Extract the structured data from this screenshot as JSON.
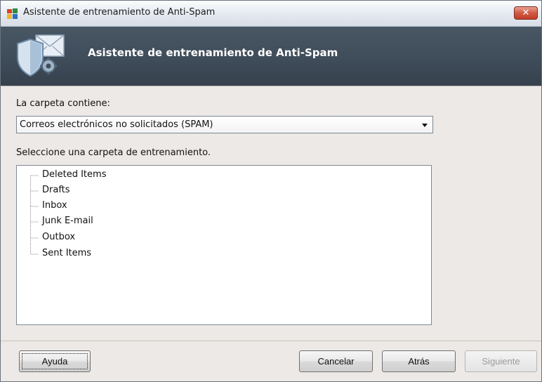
{
  "window": {
    "title": "Asistente de entrenamiento de Anti-Spam",
    "close_label": "✕"
  },
  "header": {
    "title": "Asistente de entrenamiento de Anti-Spam"
  },
  "form": {
    "folder_contains_label": "La carpeta contiene:",
    "folder_type": {
      "selected": "Correos electrónicos no solicitados (SPAM)"
    },
    "select_folder_label": "Seleccione una carpeta de entrenamiento.",
    "folders": [
      {
        "label": "Deleted Items"
      },
      {
        "label": "Drafts"
      },
      {
        "label": "Inbox"
      },
      {
        "label": "Junk E-mail"
      },
      {
        "label": "Outbox"
      },
      {
        "label": "Sent Items"
      }
    ]
  },
  "buttons": {
    "help": "Ayuda",
    "cancel": "Cancelar",
    "back": "Atrás",
    "next": "Siguiente"
  }
}
